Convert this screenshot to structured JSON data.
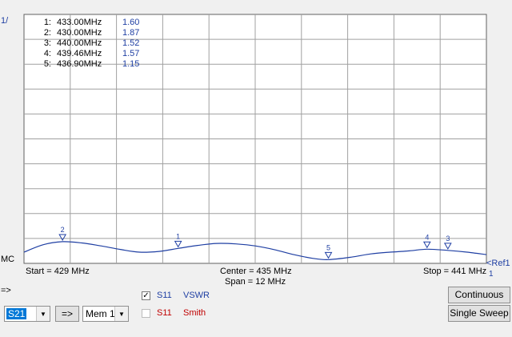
{
  "chart_data": {
    "type": "line",
    "x_start_mhz": 429,
    "x_stop_mhz": 441,
    "ylim": [
      1,
      11
    ],
    "grid": true,
    "trace": {
      "x": [
        429,
        429.5,
        430,
        430.5,
        431,
        431.5,
        432,
        432.5,
        433,
        433.5,
        434,
        434.5,
        435,
        435.5,
        436,
        436.5,
        436.9,
        437.5,
        438,
        438.5,
        439,
        439.46,
        440,
        440.5,
        441
      ],
      "y": [
        1.45,
        1.75,
        1.87,
        1.82,
        1.7,
        1.56,
        1.45,
        1.48,
        1.6,
        1.72,
        1.8,
        1.78,
        1.7,
        1.55,
        1.35,
        1.2,
        1.15,
        1.25,
        1.38,
        1.45,
        1.5,
        1.57,
        1.52,
        1.45,
        1.35
      ],
      "color": "#1f3fa3"
    },
    "markers": [
      {
        "id": "1",
        "x": 433.0,
        "y": 1.6
      },
      {
        "id": "2",
        "x": 430.0,
        "y": 1.87
      },
      {
        "id": "3",
        "x": 440.0,
        "y": 1.52
      },
      {
        "id": "4",
        "x": 439.46,
        "y": 1.57
      },
      {
        "id": "5",
        "x": 436.9,
        "y": 1.15
      }
    ],
    "marker_table": [
      {
        "num": "1:",
        "freq": "433.00MHz",
        "val": "1.60"
      },
      {
        "num": "2:",
        "freq": "430.00MHz",
        "val": "1.87"
      },
      {
        "num": "3:",
        "freq": "440.00MHz",
        "val": "1.52"
      },
      {
        "num": "4:",
        "freq": "439.46MHz",
        "val": "1.57"
      },
      {
        "num": "5:",
        "freq": "436.90MHz",
        "val": "1.15"
      }
    ],
    "top_left_label": "1/",
    "bottom_left_label": "MC",
    "ref_label": "<Ref1",
    "ref_sub": "1",
    "start_label": "Start = 429 MHz",
    "center_label": "Center = 435 MHz",
    "span_label": "Span = 12 MHz",
    "stop_label": "Stop = 441 MHz",
    "colors": {
      "grid": "#a0a0a0",
      "frame": "#606060",
      "marker_text": "#1f3fa3",
      "table_value": "#1f3fa3"
    }
  },
  "controls": {
    "arrow_label": "=>",
    "channel_select": "S21",
    "transfer_button": "=>",
    "memory_select": "Mem 1",
    "trace1": {
      "checked": true,
      "param": "S11",
      "format": "VSWR",
      "color": "#1f3fa3"
    },
    "trace2": {
      "checked": false,
      "param": "S11",
      "format": "Smith",
      "color": "#c00000"
    },
    "continuous_button": "Continuous",
    "single_sweep_button": "Single Sweep"
  }
}
